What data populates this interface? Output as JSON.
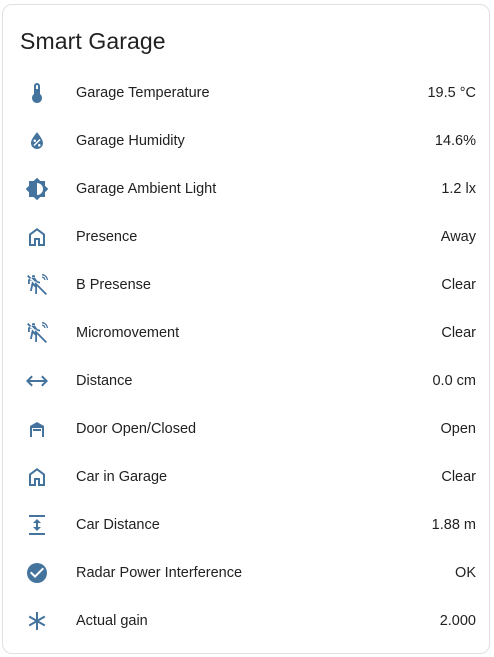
{
  "card": {
    "title": "Smart Garage"
  },
  "colors": {
    "icon": "#44739e",
    "text": "#212121",
    "border": "#e0e0e0"
  },
  "entities": [
    {
      "icon": "thermometer-icon",
      "name": "Garage Temperature",
      "state": "19.5 °C"
    },
    {
      "icon": "water-percent-icon",
      "name": "Garage Humidity",
      "state": "14.6%"
    },
    {
      "icon": "brightness-icon",
      "name": "Garage Ambient Light",
      "state": "1.2 lx"
    },
    {
      "icon": "home-outline-icon",
      "name": "Presence",
      "state": "Away"
    },
    {
      "icon": "motion-sensor-off-icon",
      "name": "B Presense",
      "state": "Clear"
    },
    {
      "icon": "motion-sensor-off-icon",
      "name": "Micromovement",
      "state": "Clear"
    },
    {
      "icon": "arrow-left-right-icon",
      "name": "Distance",
      "state": "0.0 cm"
    },
    {
      "icon": "garage-open-icon",
      "name": "Door Open/Closed",
      "state": "Open"
    },
    {
      "icon": "home-outline-icon",
      "name": "Car in Garage",
      "state": "Clear"
    },
    {
      "icon": "arrow-expand-vertical-icon",
      "name": "Car Distance",
      "state": "1.88 m"
    },
    {
      "icon": "check-circle-icon",
      "name": "Radar Power Interference",
      "state": "OK"
    },
    {
      "icon": "asterisk-icon",
      "name": "Actual gain",
      "state": "2.000"
    }
  ]
}
